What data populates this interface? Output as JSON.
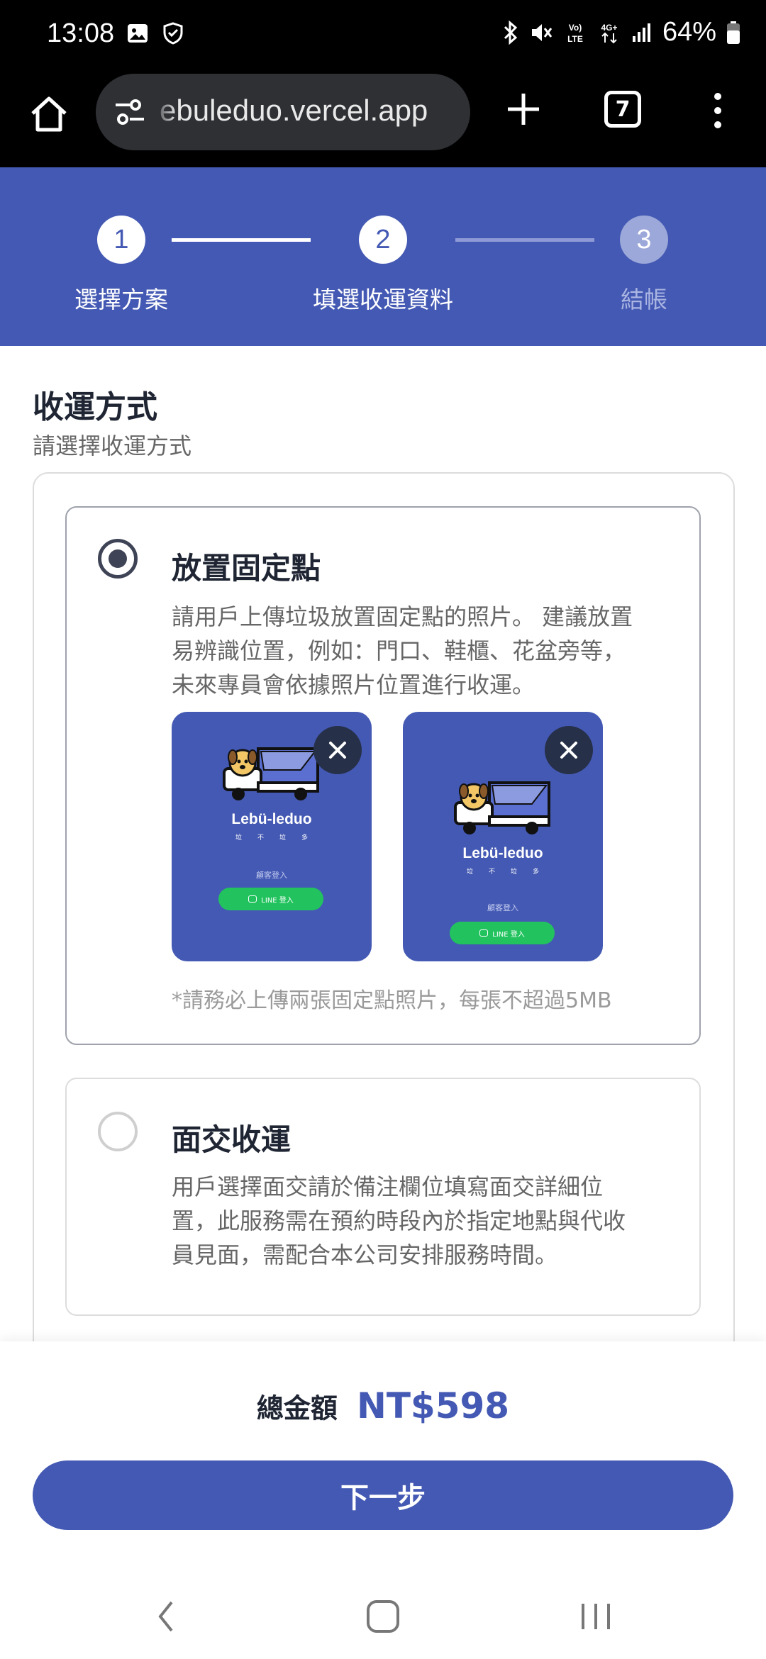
{
  "status_bar": {
    "time": "13:08",
    "left_icons": [
      "image-icon",
      "shield-icon"
    ],
    "right_icons": [
      "bluetooth-icon",
      "mute-icon",
      "volte-icon",
      "4g-icon",
      "signal-icon"
    ],
    "volte_label": "VoLTE",
    "network_label": "4G+",
    "battery": "64%"
  },
  "browser": {
    "url": "ebuleduo.vercel.app",
    "tab_count": "7"
  },
  "stepper": {
    "steps": [
      {
        "number": "1",
        "label": "選擇方案",
        "state": "done"
      },
      {
        "number": "2",
        "label": "填選收運資料",
        "state": "current"
      },
      {
        "number": "3",
        "label": "結帳",
        "state": "todo"
      }
    ]
  },
  "section": {
    "title": "收運方式",
    "subtitle": "請選擇收運方式"
  },
  "options": [
    {
      "title": "放置固定點",
      "selected": true,
      "description_lines": [
        "請用戶上傳垃圾放置固定點的照片。 建議放置",
        "易辨識位置，例如：門口、鞋櫃、花盆旁等，",
        "未來專員會依據照片位置進行收運。"
      ],
      "photos": [
        {
          "brand": "Lebü-leduo",
          "tagline": "垃不垃多",
          "guest_login": "顧客登入",
          "line_button": "LINE 登入"
        },
        {
          "brand": "Lebü-leduo",
          "tagline": "垃不垃多",
          "guest_login": "顧客登入",
          "line_button": "LINE 登入"
        }
      ],
      "note": "*請務必上傳兩張固定點照片，每張不超過5MB"
    },
    {
      "title": "面交收運",
      "selected": false,
      "description_lines": [
        "用戶選擇面交請於備注欄位填寫面交詳細位",
        "置，此服務需在預約時段內於指定地點與代收",
        "員見面，需配合本公司安排服務時間。"
      ]
    }
  ],
  "footer": {
    "total_label": "總金額",
    "total_value": "NT$598",
    "next_button": "下一步"
  },
  "colors": {
    "brand_blue": "#4459b3",
    "line_green": "#22c35e",
    "text_dark": "#1f2533"
  }
}
